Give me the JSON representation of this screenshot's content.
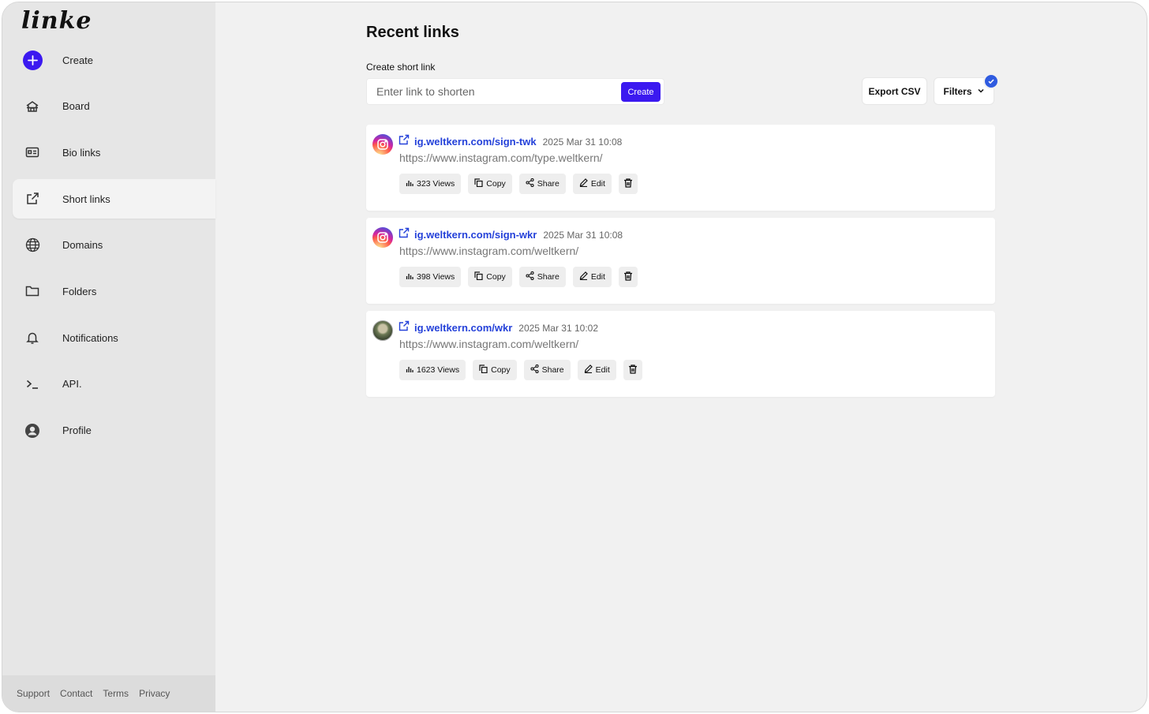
{
  "app": {
    "logo": "linke"
  },
  "sidebar": {
    "items": [
      {
        "label": "Create",
        "icon": "plus-circle-icon"
      },
      {
        "label": "Board",
        "icon": "home-icon"
      },
      {
        "label": "Bio links",
        "icon": "id-card-icon"
      },
      {
        "label": "Short links",
        "icon": "external-link-icon",
        "active": true
      },
      {
        "label": "Domains",
        "icon": "globe-icon"
      },
      {
        "label": "Folders",
        "icon": "folder-icon"
      },
      {
        "label": "Notifications",
        "icon": "bell-icon"
      },
      {
        "label": "API.",
        "icon": "terminal-icon"
      },
      {
        "label": "Profile",
        "icon": "user-circle-icon"
      }
    ],
    "footer": [
      "Support",
      "Contact",
      "Terms",
      "Privacy"
    ]
  },
  "main": {
    "title": "Recent links",
    "create_label": "Create short link",
    "input_placeholder": "Enter link to shorten",
    "create_button": "Create",
    "export_button": "Export CSV",
    "filters_button": "Filters"
  },
  "links": [
    {
      "short": "ig.weltkern.com/sign-twk",
      "date": "2025 Mar 31 10:08",
      "dest": "https://www.instagram.com/type.weltkern/",
      "views": "323 Views",
      "avatar": "instagram"
    },
    {
      "short": "ig.weltkern.com/sign-wkr",
      "date": "2025 Mar 31 10:08",
      "dest": "https://www.instagram.com/weltkern/",
      "views": "398 Views",
      "avatar": "instagram"
    },
    {
      "short": "ig.weltkern.com/wkr",
      "date": "2025 Mar 31 10:02",
      "dest": "https://www.instagram.com/weltkern/",
      "views": "1623 Views",
      "avatar": "photo"
    }
  ],
  "actions": {
    "copy": "Copy",
    "share": "Share",
    "edit": "Edit"
  },
  "colors": {
    "accent": "#3b19f0",
    "link": "#2441d9",
    "badge": "#2f5be0"
  }
}
